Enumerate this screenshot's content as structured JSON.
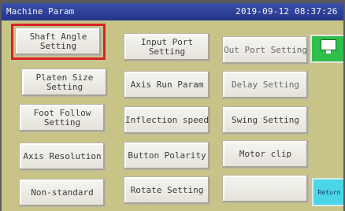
{
  "titlebar": {
    "title": "Machine Param",
    "datetime": "2019-09-12 08:37:26"
  },
  "buttons": [
    {
      "label": "Shaft Angle\nSetting"
    },
    {
      "label": "Input Port\nSetting"
    },
    {
      "label": "Out Port Setting"
    },
    {
      "label": "Platen Size\nSetting"
    },
    {
      "label": "Axis Run Param"
    },
    {
      "label": "Delay Setting"
    },
    {
      "label": "Foot Follow\nSetting"
    },
    {
      "label": "Inflection speed"
    },
    {
      "label": "Swing Setting"
    },
    {
      "label": "Axis Resolution"
    },
    {
      "label": "Button Polarity"
    },
    {
      "label": "Motor clip"
    },
    {
      "label": "Non-standard"
    },
    {
      "label": "Rotate Setting"
    },
    {
      "label": ""
    }
  ],
  "side": {
    "top_label": "",
    "return_label": "Return"
  },
  "selected_button": "Shaft Angle Setting",
  "colors": {
    "screen_bg": "#c8c488",
    "titlebar": "#2b3f98",
    "selection_outline": "#d8202a",
    "top_side_button": "#2fbf4a",
    "return_button": "#4bd6e8"
  }
}
